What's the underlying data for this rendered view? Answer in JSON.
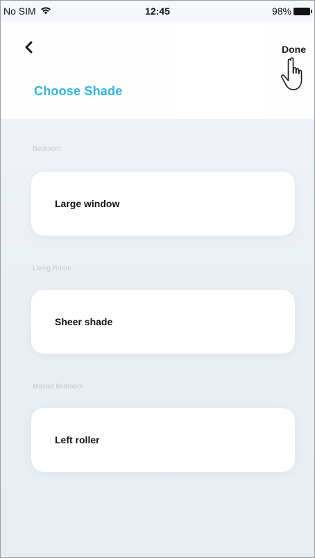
{
  "status_bar": {
    "carrier": "No SIM",
    "time": "12:45",
    "battery_percent": "98%",
    "battery_level": 0.98,
    "icons": [
      "wifi-icon",
      "battery-icon"
    ]
  },
  "header": {
    "back_icon": "chevron-left-icon",
    "done_label": "Done",
    "title": "Choose Shade",
    "title_color": "#2ab3e0"
  },
  "sections": [
    {
      "label": "Bedroom",
      "item": "Large window"
    },
    {
      "label": "Living Room",
      "item": "Sheer shade"
    },
    {
      "label": "Master bedroom",
      "item": "Left roller"
    }
  ],
  "colors": {
    "accent": "#2ab3e0",
    "background": "#eef2f6",
    "card": "#ffffff",
    "text": "#111111"
  }
}
